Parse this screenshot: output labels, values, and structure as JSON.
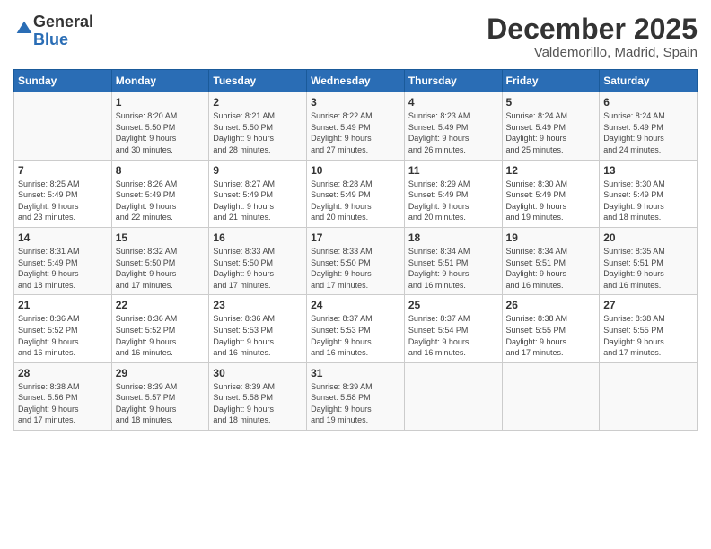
{
  "logo": {
    "general": "General",
    "blue": "Blue"
  },
  "title": "December 2025",
  "subtitle": "Valdemorillo, Madrid, Spain",
  "headers": [
    "Sunday",
    "Monday",
    "Tuesday",
    "Wednesday",
    "Thursday",
    "Friday",
    "Saturday"
  ],
  "weeks": [
    [
      {
        "day": "",
        "info": ""
      },
      {
        "day": "1",
        "info": "Sunrise: 8:20 AM\nSunset: 5:50 PM\nDaylight: 9 hours\nand 30 minutes."
      },
      {
        "day": "2",
        "info": "Sunrise: 8:21 AM\nSunset: 5:50 PM\nDaylight: 9 hours\nand 28 minutes."
      },
      {
        "day": "3",
        "info": "Sunrise: 8:22 AM\nSunset: 5:49 PM\nDaylight: 9 hours\nand 27 minutes."
      },
      {
        "day": "4",
        "info": "Sunrise: 8:23 AM\nSunset: 5:49 PM\nDaylight: 9 hours\nand 26 minutes."
      },
      {
        "day": "5",
        "info": "Sunrise: 8:24 AM\nSunset: 5:49 PM\nDaylight: 9 hours\nand 25 minutes."
      },
      {
        "day": "6",
        "info": "Sunrise: 8:24 AM\nSunset: 5:49 PM\nDaylight: 9 hours\nand 24 minutes."
      }
    ],
    [
      {
        "day": "7",
        "info": "Sunrise: 8:25 AM\nSunset: 5:49 PM\nDaylight: 9 hours\nand 23 minutes."
      },
      {
        "day": "8",
        "info": "Sunrise: 8:26 AM\nSunset: 5:49 PM\nDaylight: 9 hours\nand 22 minutes."
      },
      {
        "day": "9",
        "info": "Sunrise: 8:27 AM\nSunset: 5:49 PM\nDaylight: 9 hours\nand 21 minutes."
      },
      {
        "day": "10",
        "info": "Sunrise: 8:28 AM\nSunset: 5:49 PM\nDaylight: 9 hours\nand 20 minutes."
      },
      {
        "day": "11",
        "info": "Sunrise: 8:29 AM\nSunset: 5:49 PM\nDaylight: 9 hours\nand 20 minutes."
      },
      {
        "day": "12",
        "info": "Sunrise: 8:30 AM\nSunset: 5:49 PM\nDaylight: 9 hours\nand 19 minutes."
      },
      {
        "day": "13",
        "info": "Sunrise: 8:30 AM\nSunset: 5:49 PM\nDaylight: 9 hours\nand 18 minutes."
      }
    ],
    [
      {
        "day": "14",
        "info": "Sunrise: 8:31 AM\nSunset: 5:49 PM\nDaylight: 9 hours\nand 18 minutes."
      },
      {
        "day": "15",
        "info": "Sunrise: 8:32 AM\nSunset: 5:50 PM\nDaylight: 9 hours\nand 17 minutes."
      },
      {
        "day": "16",
        "info": "Sunrise: 8:33 AM\nSunset: 5:50 PM\nDaylight: 9 hours\nand 17 minutes."
      },
      {
        "day": "17",
        "info": "Sunrise: 8:33 AM\nSunset: 5:50 PM\nDaylight: 9 hours\nand 17 minutes."
      },
      {
        "day": "18",
        "info": "Sunrise: 8:34 AM\nSunset: 5:51 PM\nDaylight: 9 hours\nand 16 minutes."
      },
      {
        "day": "19",
        "info": "Sunrise: 8:34 AM\nSunset: 5:51 PM\nDaylight: 9 hours\nand 16 minutes."
      },
      {
        "day": "20",
        "info": "Sunrise: 8:35 AM\nSunset: 5:51 PM\nDaylight: 9 hours\nand 16 minutes."
      }
    ],
    [
      {
        "day": "21",
        "info": "Sunrise: 8:36 AM\nSunset: 5:52 PM\nDaylight: 9 hours\nand 16 minutes."
      },
      {
        "day": "22",
        "info": "Sunrise: 8:36 AM\nSunset: 5:52 PM\nDaylight: 9 hours\nand 16 minutes."
      },
      {
        "day": "23",
        "info": "Sunrise: 8:36 AM\nSunset: 5:53 PM\nDaylight: 9 hours\nand 16 minutes."
      },
      {
        "day": "24",
        "info": "Sunrise: 8:37 AM\nSunset: 5:53 PM\nDaylight: 9 hours\nand 16 minutes."
      },
      {
        "day": "25",
        "info": "Sunrise: 8:37 AM\nSunset: 5:54 PM\nDaylight: 9 hours\nand 16 minutes."
      },
      {
        "day": "26",
        "info": "Sunrise: 8:38 AM\nSunset: 5:55 PM\nDaylight: 9 hours\nand 17 minutes."
      },
      {
        "day": "27",
        "info": "Sunrise: 8:38 AM\nSunset: 5:55 PM\nDaylight: 9 hours\nand 17 minutes."
      }
    ],
    [
      {
        "day": "28",
        "info": "Sunrise: 8:38 AM\nSunset: 5:56 PM\nDaylight: 9 hours\nand 17 minutes."
      },
      {
        "day": "29",
        "info": "Sunrise: 8:39 AM\nSunset: 5:57 PM\nDaylight: 9 hours\nand 18 minutes."
      },
      {
        "day": "30",
        "info": "Sunrise: 8:39 AM\nSunset: 5:58 PM\nDaylight: 9 hours\nand 18 minutes."
      },
      {
        "day": "31",
        "info": "Sunrise: 8:39 AM\nSunset: 5:58 PM\nDaylight: 9 hours\nand 19 minutes."
      },
      {
        "day": "",
        "info": ""
      },
      {
        "day": "",
        "info": ""
      },
      {
        "day": "",
        "info": ""
      }
    ]
  ]
}
